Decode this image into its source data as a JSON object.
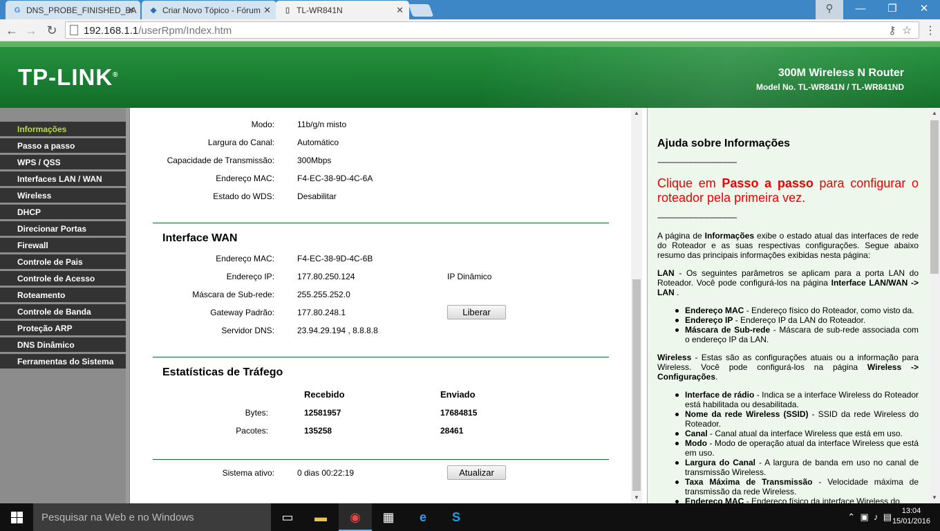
{
  "browser": {
    "tabs": [
      {
        "title": "DNS_PROBE_FINISHED_BA",
        "icon": "google-g-icon",
        "color": "#4285f4"
      },
      {
        "title": "Criar Novo Tópico - Fórum",
        "icon": "forum-icon",
        "color": "#2f6fb0"
      },
      {
        "title": "TL-WR841N",
        "icon": "page-icon",
        "color": "#666666"
      }
    ],
    "url_host": "192.168.1.1",
    "url_path": "/userRpm/Index.htm"
  },
  "header": {
    "logo": "TP-LINK",
    "logo_mark": "®",
    "product": "300M Wireless N Router",
    "model": "Model No. TL-WR841N / TL-WR841ND"
  },
  "sidebar": {
    "items": [
      "Informações",
      "Passo a passo",
      "WPS / QSS",
      "Interfaces LAN / WAN",
      "Wireless",
      "DHCP",
      "Direcionar Portas",
      "Firewall",
      "Controle de Pais",
      "Controle de Acesso",
      "Roteamento",
      "Controle de Banda",
      "Proteção ARP",
      "DNS Dinâmico",
      "Ferramentas do Sistema"
    ],
    "active_index": 0
  },
  "wireless": {
    "rows": [
      {
        "label": "Modo:",
        "value": "11b/g/n misto"
      },
      {
        "label": "Largura do Canal:",
        "value": "Automático"
      },
      {
        "label": "Capacidade de Transmissão:",
        "value": "300Mbps"
      },
      {
        "label": "Endereço MAC:",
        "value": "F4-EC-38-9D-4C-6A"
      },
      {
        "label": "Estado do WDS:",
        "value": "Desabilitar"
      }
    ]
  },
  "wan": {
    "title": "Interface WAN",
    "rows": [
      {
        "label": "Endereço MAC:",
        "value": "F4-EC-38-9D-4C-6B"
      },
      {
        "label": "Endereço IP:",
        "value": "177.80.250.124"
      },
      {
        "label": "Máscara de Sub-rede:",
        "value": "255.255.252.0"
      },
      {
        "label": "Gateway Padrão:",
        "value": "177.80.248.1"
      },
      {
        "label": "Servidor DNS:",
        "value": "23.94.29.194 , 8.8.8.8"
      }
    ],
    "ip_type": "IP Dinâmico",
    "release_button": "Liberar"
  },
  "traffic": {
    "title": "Estatísticas de Tráfego",
    "col_received": "Recebido",
    "col_sent": "Enviado",
    "rows": [
      {
        "label": "Bytes:",
        "received": "12581957",
        "sent": "17684815"
      },
      {
        "label": "Pacotes:",
        "received": "135258",
        "sent": "28461"
      }
    ]
  },
  "uptime": {
    "label": "Sistema ativo:",
    "value": "0 dias 00:22:19",
    "refresh_button": "Atualizar"
  },
  "help": {
    "title": "Ajuda sobre Informações",
    "dashes": "-------------------------------------------",
    "red_pre": "Clique em ",
    "red_link": "Passo a passo",
    "red_post": " para configurar o roteador pela primeira vez.",
    "p1_pre": "A página de ",
    "p1_bold": "Informações",
    "p1_post": " exibe o estado atual das interfaces de rede do Roteador e as suas respectivas configurações. Segue abaixo resumo das principais informações exibidas nesta página:",
    "lan_bold": "LAN",
    "lan_text": " - Os seguintes parâmetros se aplicam para a porta LAN do Roteador. Você pode configurá-los na página ",
    "lan_link": "Interface LAN/WAN ->",
    "lan_link2": "LAN",
    "lan_end": ".",
    "lan_items": [
      {
        "b": "Endereço MAC",
        "t": " - Endereço físico do Roteador, como visto da."
      },
      {
        "b": "Endereço IP",
        "t": " - Endereço IP da LAN do Roteador."
      },
      {
        "b": "Máscara de Sub-rede",
        "t": " - Máscara de sub-rede associada com o endereço IP da LAN."
      }
    ],
    "wl_bold": "Wireless",
    "wl_text": " - Estas são as configurações atuais ou a informação para Wireless. Você pode configurá-los na página ",
    "wl_link": "Wireless -> Configurações",
    "wl_end": ".",
    "wl_items": [
      {
        "b": "Interface de rádio",
        "t": " - Indica se a interface Wireless do Roteador está habilitada ou desabilitada."
      },
      {
        "b": "Nome da rede Wireless (SSID)",
        "t": " - SSID da rede Wireless do Roteador."
      },
      {
        "b": "Canal",
        "t": " - Canal atual da interface Wireless que está em uso."
      },
      {
        "b": "Modo",
        "t": " - Modo de operação atual da interface Wireless que está em uso."
      },
      {
        "b": "Largura do Canal",
        "t": " - A largura de banda em uso no canal de transmissão Wireless."
      },
      {
        "b": "Taxa Máxima de Transmissão",
        "t": " - Velocidade máxima de transmissão da rede Wireless."
      },
      {
        "b": "Endereço MAC",
        "t": " - Endereço físico da interface Wireless do"
      }
    ]
  },
  "taskbar": {
    "search_placeholder": "Pesquisar na Web e no Windows",
    "time": "13:04",
    "date": "15/01/2016"
  }
}
